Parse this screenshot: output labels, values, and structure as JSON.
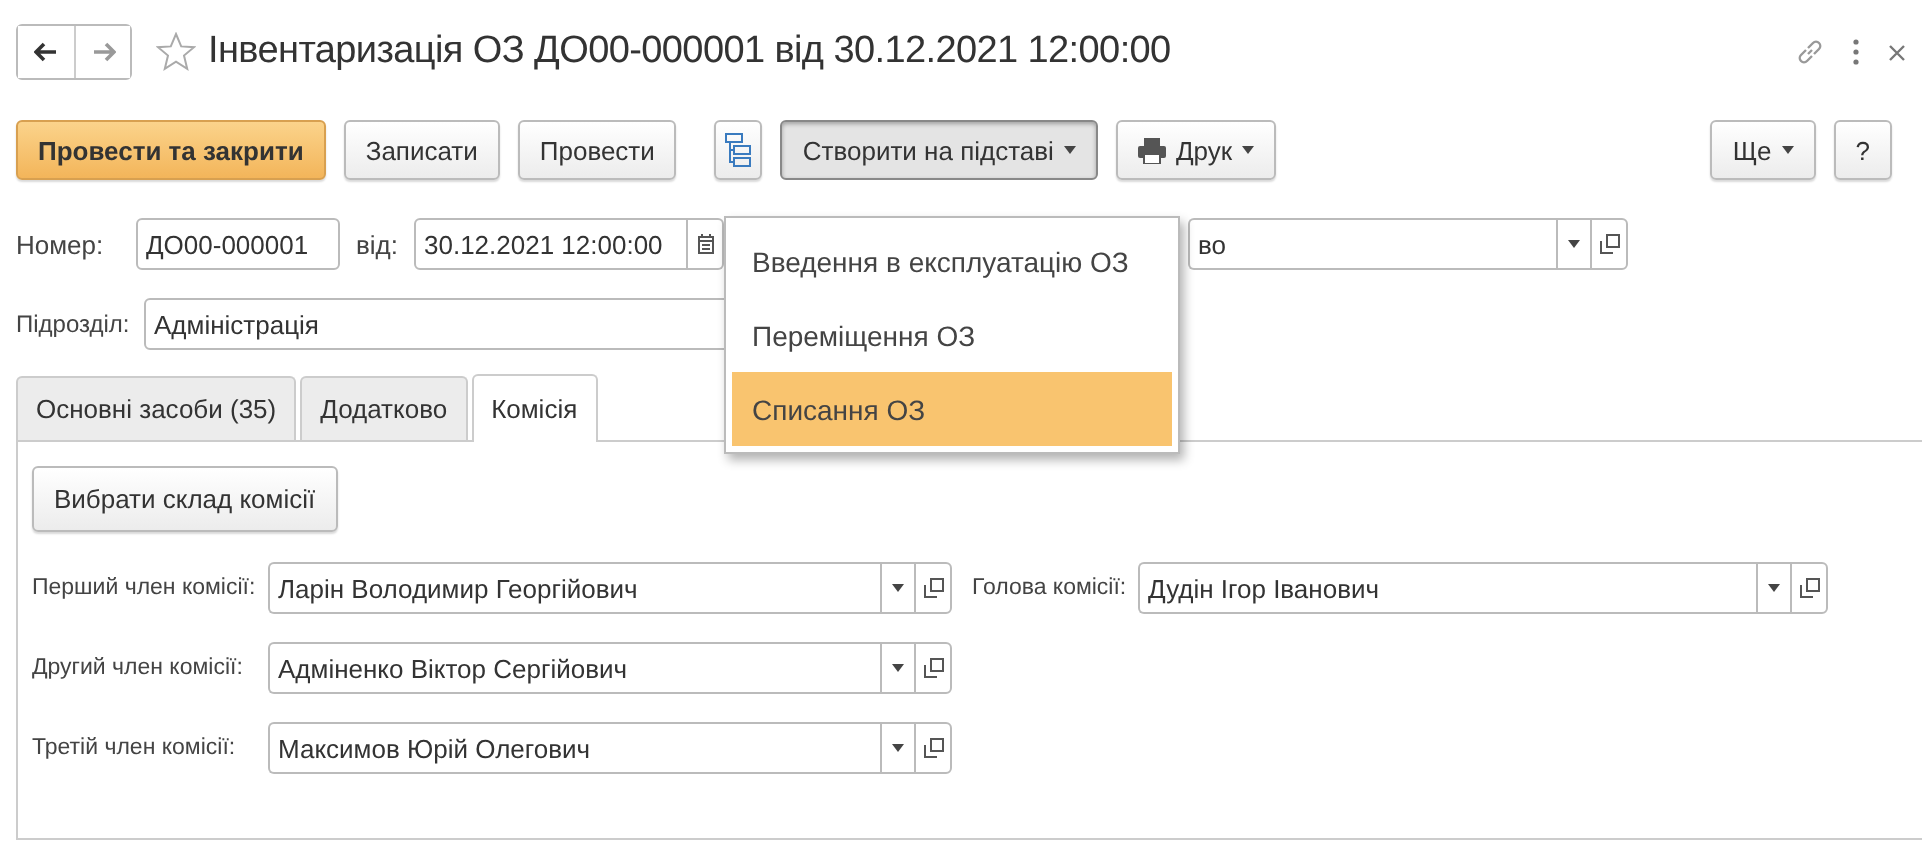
{
  "window": {
    "title": "Інвентаризація ОЗ ДО00-000001 від 30.12.2021 12:00:00",
    "favorite": false
  },
  "toolbar": {
    "buttons": [
      {
        "kind": "primary",
        "label": "Провести та закрити",
        "pressed": false
      },
      {
        "kind": "plain",
        "label": "Записати",
        "pressed": false
      },
      {
        "kind": "plain",
        "label": "Провести",
        "pressed": false
      },
      {
        "kind": "structure",
        "pressed": false
      },
      {
        "kind": "menu",
        "label": "Створити на підставі",
        "pressed": true
      },
      {
        "kind": "print",
        "label": "Друк",
        "pressed": false
      }
    ],
    "right": [
      {
        "kind": "menu",
        "label": "Ще",
        "pressed": false
      },
      {
        "kind": "plain",
        "label": "?",
        "pressed": false
      }
    ]
  },
  "header": {
    "number_label": "Номер:",
    "number": "ДО00-000001",
    "date_label": "від:",
    "date": "30.12.2021 12:00:00",
    "organization_fragment": "во",
    "subdivision_label": "Підрозділ:",
    "subdivision": "Адміністрація"
  },
  "menu": {
    "items": [
      {
        "label": "Введення в експлуатацію ОЗ",
        "selected": false
      },
      {
        "label": "Переміщення ОЗ",
        "selected": false
      },
      {
        "label": "Списання ОЗ",
        "selected": true
      }
    ]
  },
  "tabs": [
    {
      "label": "Основні засоби (35)",
      "selected": false
    },
    {
      "label": "Додатково",
      "selected": false
    },
    {
      "label": "Комісія",
      "selected": true
    }
  ],
  "commission": {
    "select_button": "Вибрати склад комісії",
    "members": [
      {
        "label": "Перший член комісії:",
        "value": "Ларін Володимир Георгійович"
      },
      {
        "label": "Другий член комісії:",
        "value": "Адміненко Віктор Сергійович"
      },
      {
        "label": "Третій член комісії:",
        "value": "Максимов Юрій Олегович"
      }
    ],
    "chair": {
      "label": "Голова комісії:",
      "value": "Дудін Ігор Іванович"
    }
  }
}
